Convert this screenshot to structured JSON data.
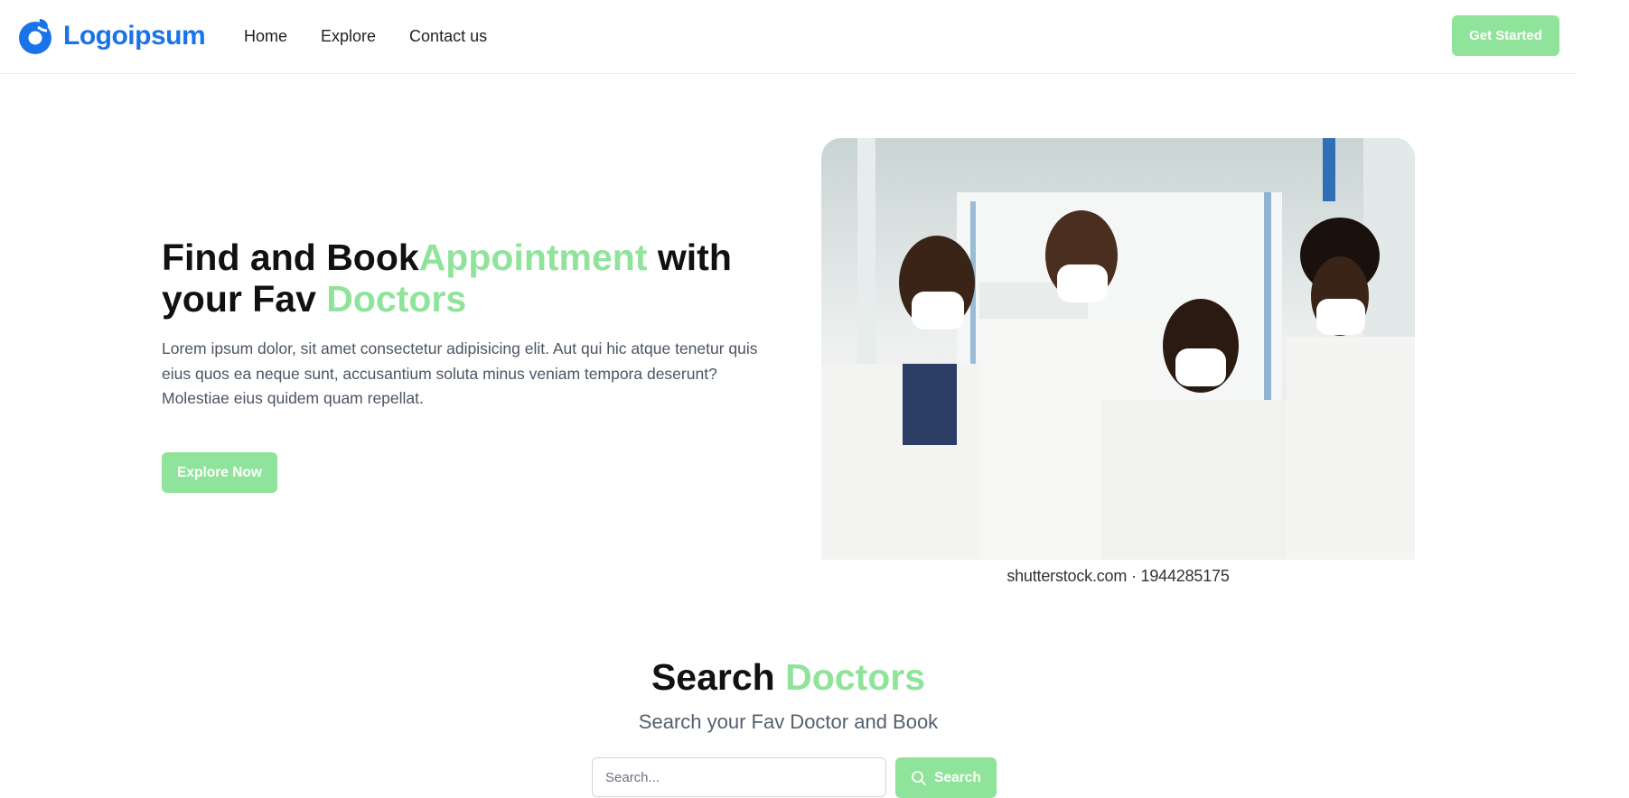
{
  "nav": {
    "brand": "Logoipsum",
    "links": [
      "Home",
      "Explore",
      "Contact us"
    ],
    "cta": "Get Started"
  },
  "hero": {
    "title_part1": "Find and Book",
    "title_accent1": "Appointment",
    "title_part2": " with your Fav ",
    "title_accent2": "Doctors",
    "description": "Lorem ipsum dolor, sit amet consectetur adipisicing elit. Aut qui hic atque tenetur quis eius quos ea neque sunt, accusantium soluta minus veniam tempora deserunt? Molestiae eius quidem quam repellat.",
    "button": "Explore Now",
    "image_caption": "shutterstock.com · 1944285175"
  },
  "search": {
    "title_plain": "Search ",
    "title_accent": "Doctors",
    "subtitle": "Search your Fav Doctor and Book",
    "placeholder": "Search...",
    "button": "Search"
  },
  "colors": {
    "accent": "#90e39a",
    "brand": "#1a73e8"
  },
  "icons": {
    "logo": "logo-drop-icon",
    "search": "search-icon"
  }
}
